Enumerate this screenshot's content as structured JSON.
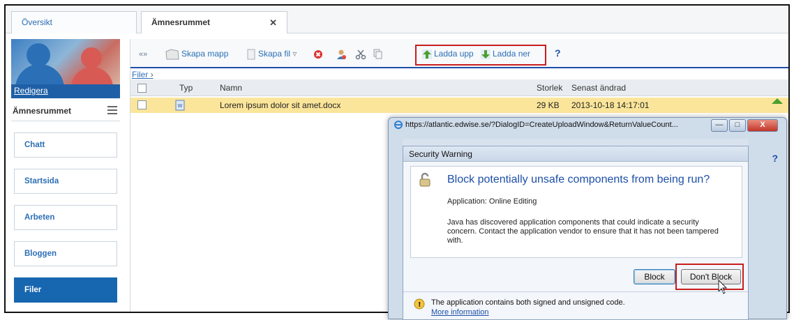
{
  "tabs": [
    {
      "label": "Översikt"
    },
    {
      "label": "Ämnesrummet",
      "close": "✕"
    }
  ],
  "sidebar": {
    "edit_link": "Redigera",
    "room_title": "Ämnesrummet",
    "nav": [
      {
        "label": "Chatt"
      },
      {
        "label": "Startsida"
      },
      {
        "label": "Arbeten"
      },
      {
        "label": "Bloggen"
      },
      {
        "label": "Filer",
        "active": true
      }
    ]
  },
  "toolbar": {
    "collapse": "«»",
    "new_folder": "Skapa mapp",
    "new_file": "Skapa fil",
    "upload": "Ladda upp",
    "download": "Ladda ner",
    "help": "?"
  },
  "breadcrumb": "Filer",
  "breadcrumb_sep": "›",
  "table": {
    "headers": {
      "type": "Typ",
      "name": "Namn",
      "size": "Storlek",
      "modified": "Senast ändrad"
    },
    "rows": [
      {
        "name": "Lorem ipsum dolor sit amet.docx",
        "size": "29 KB",
        "modified": "2013-10-18 14:17:01"
      }
    ]
  },
  "browser_window": {
    "url": "https://atlantic.edwise.se/?DialogID=CreateUploadWindow&ReturnValueCount...",
    "help": "?"
  },
  "security_dialog": {
    "title": "Security Warning",
    "heading": "Block potentially unsafe components from being run?",
    "application": "Application: Online Editing",
    "message": "Java has discovered application components that could indicate a security concern. Contact the application vendor to ensure that it has not been tampered with.",
    "block_button": "Block",
    "dont_block_button": "Don't Block",
    "footer": "The application contains both signed and unsigned code.",
    "more_info": "More information"
  },
  "colors": {
    "accent": "#1766b0",
    "highlight": "#c91d1d",
    "row_selected": "#fbe59a"
  }
}
